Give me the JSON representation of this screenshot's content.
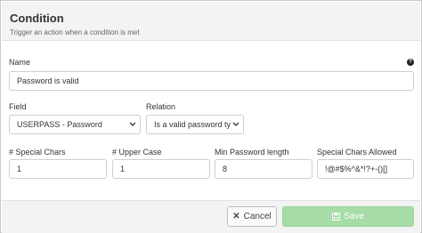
{
  "header": {
    "title": "Condition",
    "subtitle": "Trigger an action when a condition is met"
  },
  "name": {
    "label": "Name",
    "value": "Password is valid",
    "help_icon": "?"
  },
  "field": {
    "label": "Field",
    "value": "USERPASS - Password"
  },
  "relation": {
    "label": "Relation",
    "value": "Is a valid password ty"
  },
  "special_chars": {
    "label": "# Special Chars",
    "value": "1"
  },
  "upper_case": {
    "label": "# Upper Case",
    "value": "1"
  },
  "min_length": {
    "label": "Min Password length",
    "value": "8"
  },
  "chars_allowed": {
    "label": "Special Chars Allowed",
    "value": "!@#$%^&*!?+-()[]"
  },
  "footer": {
    "cancel_label": "Cancel",
    "save_label": "Save",
    "cancel_icon": "close-icon",
    "save_icon": "floppy-disk-icon",
    "save_color": "#a6dca6"
  }
}
